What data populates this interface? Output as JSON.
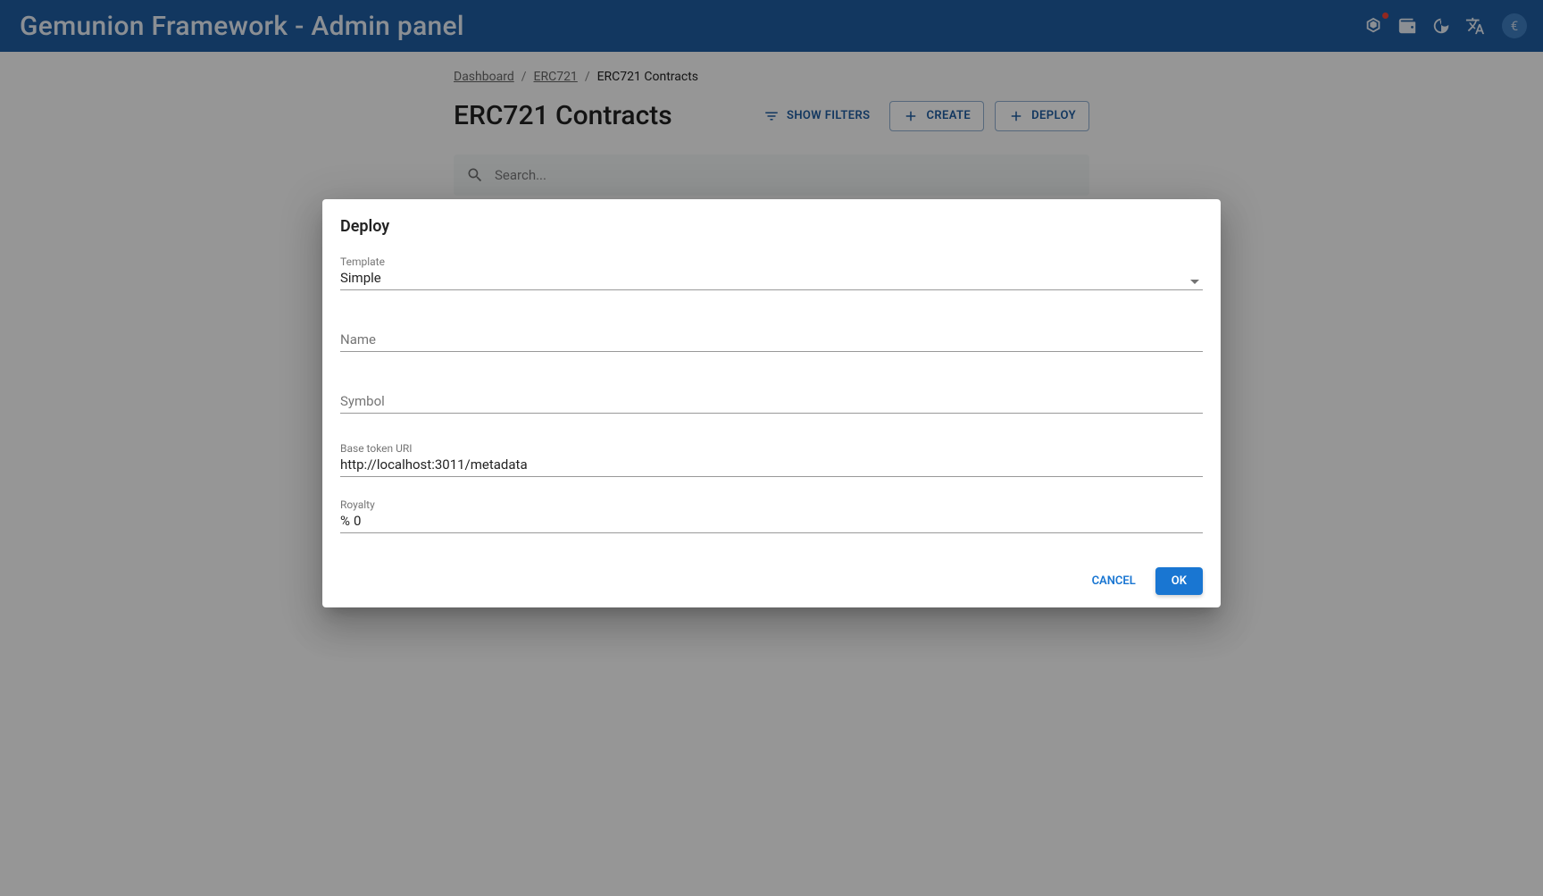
{
  "appbar": {
    "title": "Gemunion Framework - Admin panel"
  },
  "breadcrumbs": {
    "items": [
      {
        "label": "Dashboard",
        "link": true
      },
      {
        "label": "ERC721",
        "link": true
      },
      {
        "label": "ERC721 Contracts",
        "link": false
      }
    ],
    "separator": "/"
  },
  "page": {
    "title": "ERC721 Contracts",
    "show_filters_label": "Show filters",
    "create_label": "Create",
    "deploy_label": "Deploy"
  },
  "search": {
    "placeholder": "Search..."
  },
  "dialog": {
    "title": "Deploy",
    "template": {
      "label": "Template",
      "value": "Simple"
    },
    "name": {
      "label": "Name",
      "value": ""
    },
    "symbol": {
      "label": "Symbol",
      "value": ""
    },
    "base_uri": {
      "label": "Base token URI",
      "value": "http://localhost:3011/metadata"
    },
    "royalty": {
      "label": "Royalty",
      "prefix": "%",
      "value": "0"
    },
    "cancel_label": "Cancel",
    "ok_label": "OK"
  }
}
